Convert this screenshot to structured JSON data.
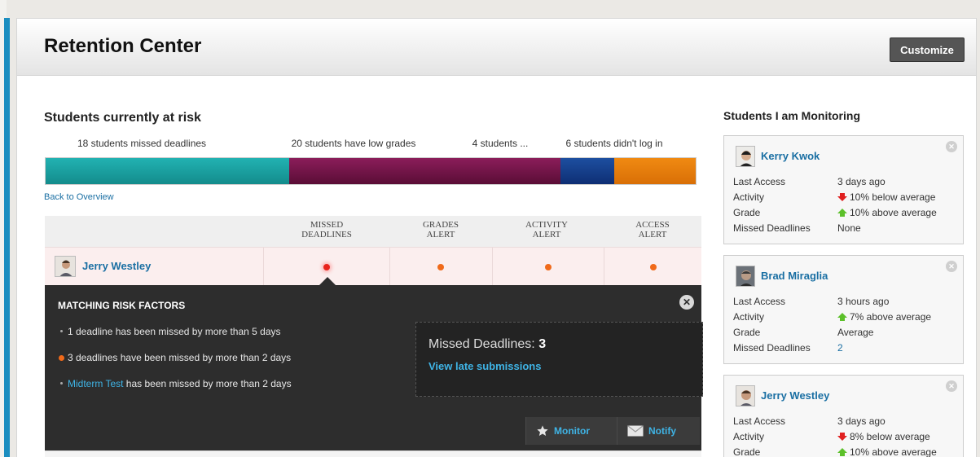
{
  "header": {
    "title": "Retention Center",
    "customize_label": "Customize"
  },
  "risk": {
    "title": "Students currently at risk",
    "segments": [
      {
        "label": "18 students missed deadlines",
        "count": 18,
        "color": "#1aa3a3"
      },
      {
        "label": "20 students have low grades",
        "count": 20,
        "color": "#751645"
      },
      {
        "label": "4 students ...",
        "count": 4,
        "color": "#163f8c"
      },
      {
        "label": "6 students didn't log in",
        "count": 6,
        "color": "#ea7d0c"
      }
    ],
    "back_link": "Back to Overview"
  },
  "table": {
    "columns": [
      {
        "line1": "Missed",
        "line2": "Deadlines"
      },
      {
        "line1": "Grades",
        "line2": "Alert"
      },
      {
        "line1": "Activity",
        "line2": "Alert"
      },
      {
        "line1": "Access",
        "line2": "Alert"
      }
    ],
    "student": {
      "name": "Jerry Westley"
    }
  },
  "popup": {
    "title": "MATCHING RISK FACTORS",
    "items": [
      {
        "text": "1 deadline has been missed by more than 5 days"
      },
      {
        "text": "3 deadlines have been missed by more than 2 days"
      },
      {
        "link": "Midterm Test",
        "text": " has been missed by more than 2 days"
      }
    ],
    "detail_label": "Missed Deadlines:",
    "detail_value": "3",
    "detail_link": "View late submissions",
    "monitor_label": "Monitor",
    "notify_label": "Notify"
  },
  "monitoring": {
    "title": "Students I am Monitoring",
    "cards": [
      {
        "name": "Kerry Kwok",
        "rows": [
          {
            "label": "Last Access",
            "value": "3 days ago"
          },
          {
            "label": "Activity",
            "value": "10% below average",
            "trend": "down"
          },
          {
            "label": "Grade",
            "value": "10% above average",
            "trend": "up"
          },
          {
            "label": "Missed Deadlines",
            "value": "None"
          }
        ]
      },
      {
        "name": "Brad Miraglia",
        "rows": [
          {
            "label": "Last Access",
            "value": "3 hours ago"
          },
          {
            "label": "Activity",
            "value": "7% above average",
            "trend": "up"
          },
          {
            "label": "Grade",
            "value": "Average"
          },
          {
            "label": "Missed Deadlines",
            "value": "2",
            "link": true
          }
        ]
      },
      {
        "name": "Jerry Westley",
        "rows": [
          {
            "label": "Last Access",
            "value": "3 days ago"
          },
          {
            "label": "Activity",
            "value": "8% below average",
            "trend": "down"
          },
          {
            "label": "Grade",
            "value": "10% above average",
            "trend": "up"
          }
        ]
      }
    ]
  }
}
